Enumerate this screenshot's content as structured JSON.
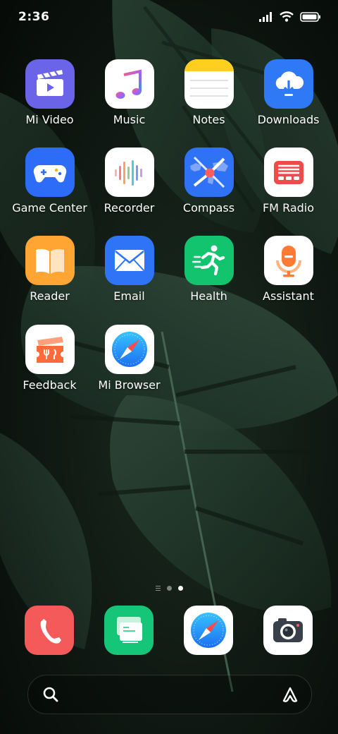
{
  "status_bar": {
    "time": "2:36",
    "icons": [
      "signal-icon",
      "wifi-icon",
      "battery-icon"
    ]
  },
  "apps": [
    {
      "label": "Mi Video",
      "icon": "mi-video-icon",
      "color": "#6b63e8"
    },
    {
      "label": "Music",
      "icon": "music-icon",
      "color": "#ffffff"
    },
    {
      "label": "Notes",
      "icon": "notes-icon",
      "color": "#ffffff"
    },
    {
      "label": "Downloads",
      "icon": "downloads-icon",
      "color": "#2f78f6"
    },
    {
      "label": "Game Center",
      "icon": "game-center-icon",
      "color": "#2c6cf6"
    },
    {
      "label": "Recorder",
      "icon": "recorder-icon",
      "color": "#ffffff"
    },
    {
      "label": "Compass",
      "icon": "compass-icon",
      "color": "#2f72f5"
    },
    {
      "label": "FM Radio",
      "icon": "fm-radio-icon",
      "color": "#ffffff"
    },
    {
      "label": "Reader",
      "icon": "reader-icon",
      "color": "#ffa533"
    },
    {
      "label": "Email",
      "icon": "email-icon",
      "color": "#2f74f6"
    },
    {
      "label": "Health",
      "icon": "health-icon",
      "color": "#12c46e"
    },
    {
      "label": "Assistant",
      "icon": "assistant-icon",
      "color": "#ffffff"
    },
    {
      "label": "Feedback",
      "icon": "feedback-icon",
      "color": "#ffffff"
    },
    {
      "label": "Mi Browser",
      "icon": "mi-browser-icon",
      "color": "#ffffff"
    }
  ],
  "page_indicator": {
    "pages": 3,
    "active_page": 3
  },
  "dock": [
    {
      "icon": "phone-icon",
      "color": "#f55a5a"
    },
    {
      "icon": "messaging-icon",
      "color": "#15c678"
    },
    {
      "icon": "browser-icon",
      "color": "#ffffff"
    },
    {
      "icon": "camera-icon",
      "color": "#ffffff"
    }
  ],
  "search_bar": {
    "left_icon": "search-icon",
    "right_icon": "assistant-a-icon"
  }
}
